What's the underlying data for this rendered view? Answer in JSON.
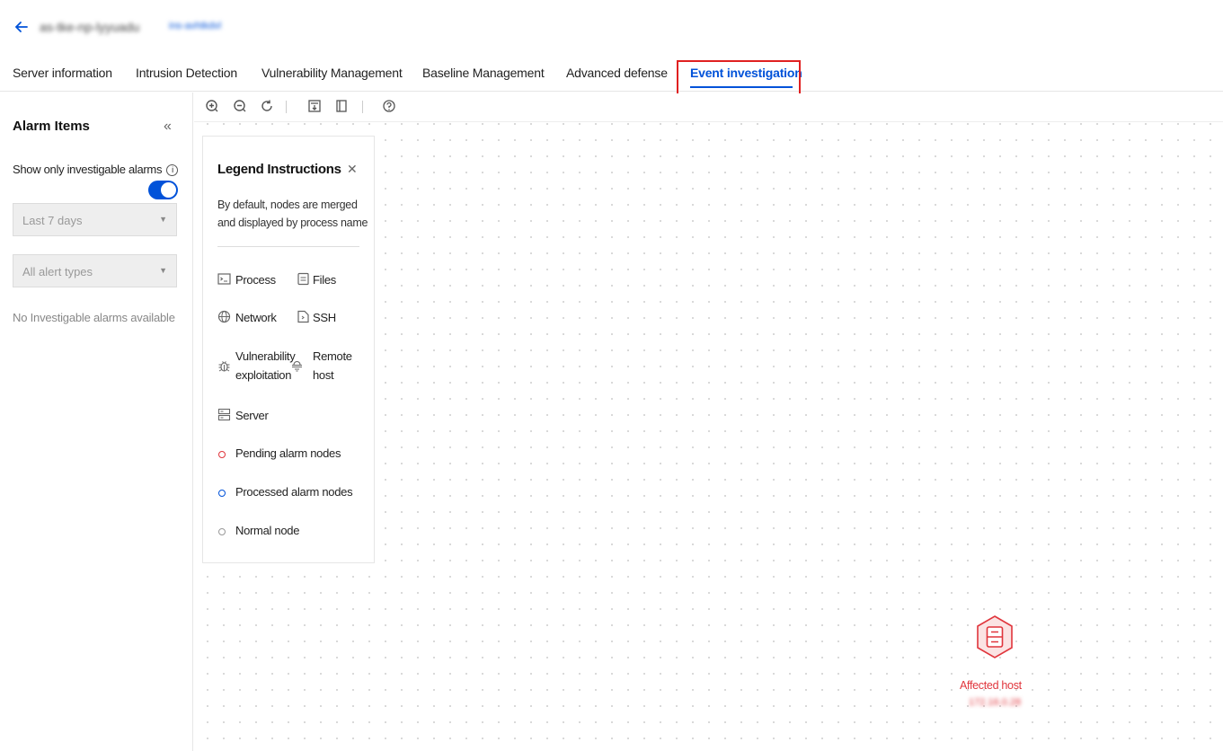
{
  "header": {
    "host_name": "as-tke-np-lyyuadu",
    "host_tag": "ins-avhtkdvl"
  },
  "tabs": [
    {
      "label": "Server information"
    },
    {
      "label": "Intrusion Detection"
    },
    {
      "label": "Vulnerability Management"
    },
    {
      "label": "Baseline Management"
    },
    {
      "label": "Advanced defense"
    },
    {
      "label": "Event investigation",
      "active": true
    }
  ],
  "sidebar": {
    "title": "Alarm Items",
    "toggle_label": "Show only investigable alarms",
    "toggle_on": true,
    "time_select": "Last 7 days",
    "type_select": "All alert types",
    "empty_text": "No Investigable alarms available"
  },
  "legend": {
    "title": "Legend Instructions",
    "description": "By default, nodes are merged and displayed by process name",
    "items": {
      "process": "Process",
      "files": "Files",
      "network": "Network",
      "ssh": "SSH",
      "vuln_line1": "Vulnerability",
      "vuln_line2": "exploitation",
      "remote_line1": "Remote",
      "remote_line2": "host",
      "server": "Server",
      "pending": "Pending alarm nodes",
      "processed": "Processed alarm nodes",
      "normal": "Normal node"
    },
    "colors": {
      "pending": "#e0353c",
      "processed": "#0052d9",
      "normal": "#999999"
    }
  },
  "node": {
    "label": "Affected host",
    "ip": "172.16.0.28"
  },
  "colors": {
    "accent": "#0052d9",
    "highlight": "#e02020"
  }
}
